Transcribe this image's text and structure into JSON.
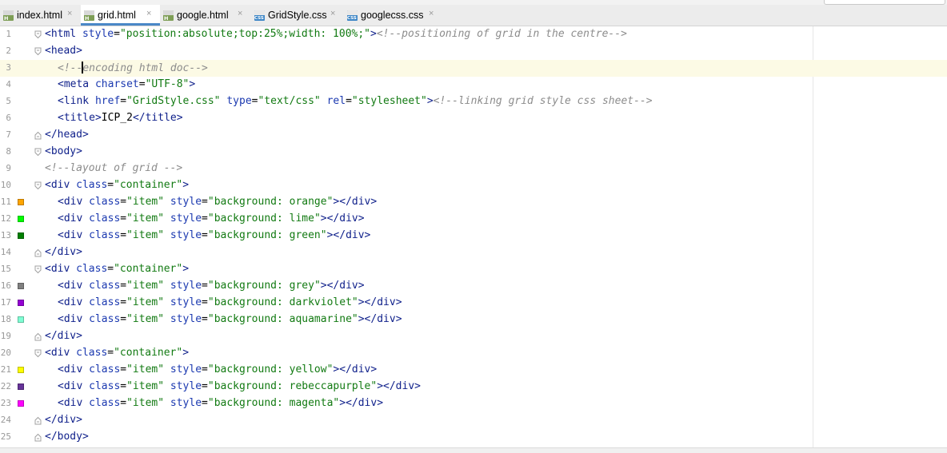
{
  "tabs": [
    {
      "label": "index.html",
      "type": "html",
      "active": false
    },
    {
      "label": "grid.html",
      "type": "html",
      "active": true
    },
    {
      "label": "google.html",
      "type": "html",
      "active": false
    },
    {
      "label": "GridStyle.css",
      "type": "css",
      "active": false
    },
    {
      "label": "googlecss.css",
      "type": "css",
      "active": false
    }
  ],
  "file_icon_letters": {
    "html": "H",
    "css": "CSS"
  },
  "close_glyph": "×",
  "current_line": 3,
  "lines": [
    {
      "n": "1",
      "fold": "open",
      "indent": 0,
      "tokens": [
        [
          "tg",
          "<html "
        ],
        [
          "at",
          "style"
        ],
        [
          "pl",
          "="
        ],
        [
          "vl",
          "\"position:absolute;top:25%;width: 100%;\""
        ],
        [
          "tg",
          ">"
        ],
        [
          "cm",
          "<!--positioning of grid in the centre-->"
        ]
      ]
    },
    {
      "n": "2",
      "fold": "open",
      "indent": 0,
      "tokens": [
        [
          "tg",
          "<head>"
        ]
      ]
    },
    {
      "n": "3",
      "fold": "",
      "indent": 1,
      "tokens": [
        [
          "cm",
          "<!--"
        ],
        [
          "caret",
          ""
        ],
        [
          "cm",
          "encoding html doc-->"
        ]
      ]
    },
    {
      "n": "4",
      "fold": "",
      "indent": 1,
      "tokens": [
        [
          "tg",
          "<meta "
        ],
        [
          "at",
          "charset"
        ],
        [
          "pl",
          "="
        ],
        [
          "vl",
          "\"UTF-8\""
        ],
        [
          "tg",
          ">"
        ]
      ]
    },
    {
      "n": "5",
      "fold": "",
      "indent": 1,
      "tokens": [
        [
          "tg",
          "<link "
        ],
        [
          "at",
          "href"
        ],
        [
          "pl",
          "="
        ],
        [
          "vl",
          "\"GridStyle.css\""
        ],
        [
          "pl",
          " "
        ],
        [
          "at",
          "type"
        ],
        [
          "pl",
          "="
        ],
        [
          "vl",
          "\"text/css\""
        ],
        [
          "pl",
          " "
        ],
        [
          "at",
          "rel"
        ],
        [
          "pl",
          "="
        ],
        [
          "vl",
          "\"stylesheet\""
        ],
        [
          "tg",
          ">"
        ],
        [
          "cm",
          "<!--linking grid style css sheet-->"
        ]
      ]
    },
    {
      "n": "6",
      "fold": "",
      "indent": 1,
      "tokens": [
        [
          "tg",
          "<title>"
        ],
        [
          "pl",
          "ICP_2"
        ],
        [
          "tg",
          "</title>"
        ]
      ]
    },
    {
      "n": "7",
      "fold": "close",
      "indent": 0,
      "tokens": [
        [
          "tg",
          "</head>"
        ]
      ]
    },
    {
      "n": "8",
      "fold": "open",
      "indent": 0,
      "tokens": [
        [
          "tg",
          "<body>"
        ]
      ]
    },
    {
      "n": "9",
      "fold": "",
      "indent": 0,
      "tokens": [
        [
          "cm",
          "<!--layout of grid -->"
        ]
      ]
    },
    {
      "n": "10",
      "fold": "open",
      "indent": 0,
      "tokens": [
        [
          "tg",
          "<div "
        ],
        [
          "at",
          "class"
        ],
        [
          "pl",
          "="
        ],
        [
          "vl",
          "\"container\""
        ],
        [
          "tg",
          ">"
        ]
      ]
    },
    {
      "n": "11",
      "fold": "",
      "indent": 1,
      "swatch": "#ffa500",
      "tokens": [
        [
          "tg",
          "<div "
        ],
        [
          "at",
          "class"
        ],
        [
          "pl",
          "="
        ],
        [
          "vl",
          "\"item\""
        ],
        [
          "pl",
          " "
        ],
        [
          "at",
          "style"
        ],
        [
          "pl",
          "="
        ],
        [
          "vl",
          "\"background: "
        ],
        [
          "vl",
          "orange"
        ],
        [
          "vl",
          "\""
        ],
        [
          "tg",
          "></div>"
        ]
      ]
    },
    {
      "n": "12",
      "fold": "",
      "indent": 1,
      "swatch": "#00ff00",
      "tokens": [
        [
          "tg",
          "<div "
        ],
        [
          "at",
          "class"
        ],
        [
          "pl",
          "="
        ],
        [
          "vl",
          "\"item\""
        ],
        [
          "pl",
          " "
        ],
        [
          "at",
          "style"
        ],
        [
          "pl",
          "="
        ],
        [
          "vl",
          "\"background: "
        ],
        [
          "vl",
          "lime"
        ],
        [
          "vl",
          "\""
        ],
        [
          "tg",
          "></div>"
        ]
      ]
    },
    {
      "n": "13",
      "fold": "",
      "indent": 1,
      "swatch": "#008000",
      "tokens": [
        [
          "tg",
          "<div "
        ],
        [
          "at",
          "class"
        ],
        [
          "pl",
          "="
        ],
        [
          "vl",
          "\"item\""
        ],
        [
          "pl",
          " "
        ],
        [
          "at",
          "style"
        ],
        [
          "pl",
          "="
        ],
        [
          "vl",
          "\"background: "
        ],
        [
          "vl",
          "green"
        ],
        [
          "vl",
          "\""
        ],
        [
          "tg",
          "></div>"
        ]
      ]
    },
    {
      "n": "14",
      "fold": "close",
      "indent": 0,
      "tokens": [
        [
          "tg",
          "</div>"
        ]
      ]
    },
    {
      "n": "15",
      "fold": "open",
      "indent": 0,
      "tokens": [
        [
          "tg",
          "<div "
        ],
        [
          "at",
          "class"
        ],
        [
          "pl",
          "="
        ],
        [
          "vl",
          "\"container\""
        ],
        [
          "tg",
          ">"
        ]
      ]
    },
    {
      "n": "16",
      "fold": "",
      "indent": 1,
      "swatch": "#808080",
      "tokens": [
        [
          "tg",
          "<div "
        ],
        [
          "at",
          "class"
        ],
        [
          "pl",
          "="
        ],
        [
          "vl",
          "\"item\""
        ],
        [
          "pl",
          " "
        ],
        [
          "at",
          "style"
        ],
        [
          "pl",
          "="
        ],
        [
          "vl",
          "\"background: "
        ],
        [
          "vl",
          "grey"
        ],
        [
          "vl",
          "\""
        ],
        [
          "tg",
          "></div>"
        ]
      ]
    },
    {
      "n": "17",
      "fold": "",
      "indent": 1,
      "swatch": "#9400d3",
      "tokens": [
        [
          "tg",
          "<div "
        ],
        [
          "at",
          "class"
        ],
        [
          "pl",
          "="
        ],
        [
          "vl",
          "\"item\""
        ],
        [
          "pl",
          " "
        ],
        [
          "at",
          "style"
        ],
        [
          "pl",
          "="
        ],
        [
          "vl",
          "\"background: "
        ],
        [
          "vl",
          "darkviolet"
        ],
        [
          "vl",
          "\""
        ],
        [
          "tg",
          "></div>"
        ]
      ]
    },
    {
      "n": "18",
      "fold": "",
      "indent": 1,
      "swatch": "#7fffd4",
      "tokens": [
        [
          "tg",
          "<div "
        ],
        [
          "at",
          "class"
        ],
        [
          "pl",
          "="
        ],
        [
          "vl",
          "\"item\""
        ],
        [
          "pl",
          " "
        ],
        [
          "at",
          "style"
        ],
        [
          "pl",
          "="
        ],
        [
          "vl",
          "\"background: "
        ],
        [
          "vl",
          "aquamarine"
        ],
        [
          "vl",
          "\""
        ],
        [
          "tg",
          "></div>"
        ]
      ]
    },
    {
      "n": "19",
      "fold": "close",
      "indent": 0,
      "tokens": [
        [
          "tg",
          "</div>"
        ]
      ]
    },
    {
      "n": "20",
      "fold": "open",
      "indent": 0,
      "tokens": [
        [
          "tg",
          "<div "
        ],
        [
          "at",
          "class"
        ],
        [
          "pl",
          "="
        ],
        [
          "vl",
          "\"container\""
        ],
        [
          "tg",
          ">"
        ]
      ]
    },
    {
      "n": "21",
      "fold": "",
      "indent": 1,
      "swatch": "#ffff00",
      "tokens": [
        [
          "tg",
          "<div "
        ],
        [
          "at",
          "class"
        ],
        [
          "pl",
          "="
        ],
        [
          "vl",
          "\"item\""
        ],
        [
          "pl",
          " "
        ],
        [
          "at",
          "style"
        ],
        [
          "pl",
          "="
        ],
        [
          "vl",
          "\"background: "
        ],
        [
          "vl",
          "yellow"
        ],
        [
          "vl",
          "\""
        ],
        [
          "tg",
          "></div>"
        ]
      ]
    },
    {
      "n": "22",
      "fold": "",
      "indent": 1,
      "swatch": "#663399",
      "tokens": [
        [
          "tg",
          "<div "
        ],
        [
          "at",
          "class"
        ],
        [
          "pl",
          "="
        ],
        [
          "vl",
          "\"item\""
        ],
        [
          "pl",
          " "
        ],
        [
          "at",
          "style"
        ],
        [
          "pl",
          "="
        ],
        [
          "vl",
          "\"background: "
        ],
        [
          "vl",
          "rebeccapurple"
        ],
        [
          "vl",
          "\""
        ],
        [
          "tg",
          "></div>"
        ]
      ]
    },
    {
      "n": "23",
      "fold": "",
      "indent": 1,
      "swatch": "#ff00ff",
      "tokens": [
        [
          "tg",
          "<div "
        ],
        [
          "at",
          "class"
        ],
        [
          "pl",
          "="
        ],
        [
          "vl",
          "\"item\""
        ],
        [
          "pl",
          " "
        ],
        [
          "at",
          "style"
        ],
        [
          "pl",
          "="
        ],
        [
          "vl",
          "\"background: "
        ],
        [
          "vl",
          "magenta"
        ],
        [
          "vl",
          "\""
        ],
        [
          "tg",
          "></div>"
        ]
      ]
    },
    {
      "n": "24",
      "fold": "close",
      "indent": 0,
      "tokens": [
        [
          "tg",
          "</div>"
        ]
      ]
    },
    {
      "n": "25",
      "fold": "close",
      "indent": 0,
      "tokens": [
        [
          "tg",
          "</body>"
        ]
      ]
    }
  ]
}
